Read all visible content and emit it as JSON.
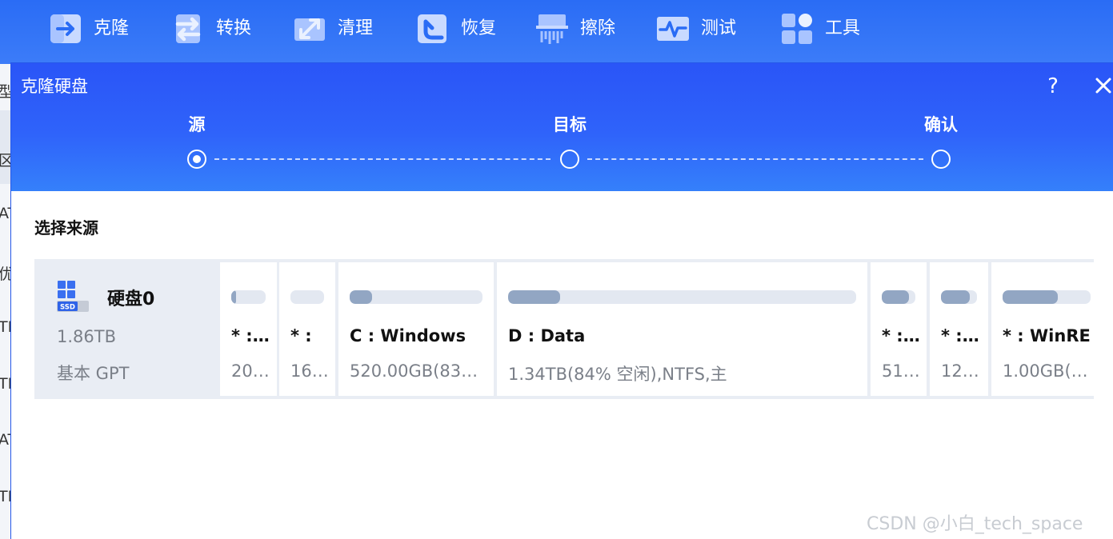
{
  "toolbar": {
    "items": [
      {
        "label": "克隆",
        "icon": "clone-arrow-icon"
      },
      {
        "label": "转换",
        "icon": "convert-arrows-icon"
      },
      {
        "label": "清理",
        "icon": "cleanup-expand-icon"
      },
      {
        "label": "恢复",
        "icon": "recover-return-icon"
      },
      {
        "label": "擦除",
        "icon": "shredder-icon"
      },
      {
        "label": "测试",
        "icon": "pulse-test-icon"
      },
      {
        "label": "工具",
        "icon": "tools-grid-icon"
      }
    ],
    "colors": {
      "background": "#2a6cf5",
      "icon_fill": "#c9daff"
    }
  },
  "dialog": {
    "title": "克隆硬盘",
    "help": "?",
    "steps": [
      {
        "label": "源",
        "active": true
      },
      {
        "label": "目标",
        "active": false
      },
      {
        "label": "确认",
        "active": false
      }
    ],
    "section_heading": "选择来源",
    "colors": {
      "header": "#2f63fa",
      "bar_fill": "#92a6c3",
      "bar_track": "#e3e8f1"
    }
  },
  "disk": {
    "name": "硬盘0",
    "size": "1.86TB",
    "type": "基本 GPT",
    "icon": "ssd-disk-icon",
    "icon_badge": "SSD",
    "partitions": [
      {
        "name": "* : ...",
        "detail": "200...",
        "used_fraction": 0.15
      },
      {
        "name": "* :",
        "detail": "16....",
        "used_fraction": 0.0
      },
      {
        "name": "C : Windows",
        "detail": "520.00GB(83% ...",
        "used_fraction": 0.17
      },
      {
        "name": "D : Data",
        "detail": "1.34TB(84% 空闲),NTFS,主",
        "used_fraction": 0.15
      },
      {
        "name": "* : ...",
        "detail": "512...",
        "used_fraction": 0.8
      },
      {
        "name": "* : ...",
        "detail": "12.0...",
        "used_fraction": 0.8
      },
      {
        "name": "* : WinRE",
        "detail": "1.00GB(35...",
        "used_fraction": 0.63
      }
    ]
  },
  "background": {
    "fragments": [
      "型",
      "区",
      "AT",
      "优",
      "TI",
      "TI",
      "AT",
      "TI"
    ]
  },
  "watermark": "CSDN @小白_tech_space"
}
